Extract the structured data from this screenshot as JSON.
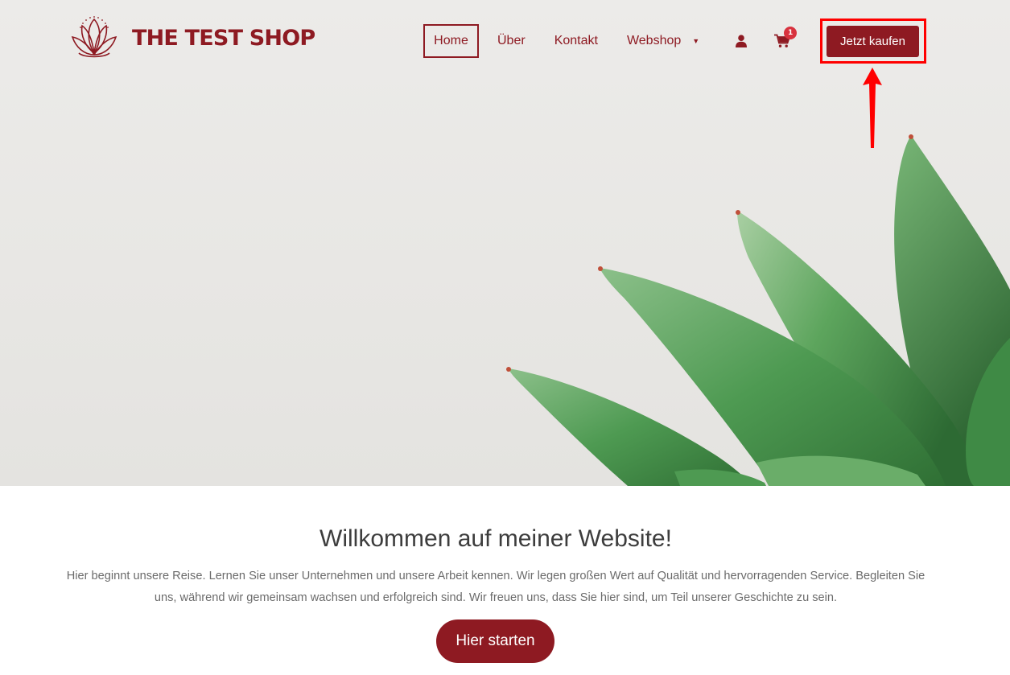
{
  "brand": {
    "name": "THE TEST SHOP",
    "color": "#8e1a22"
  },
  "nav": {
    "items": [
      {
        "label": "Home",
        "active": true
      },
      {
        "label": "Über"
      },
      {
        "label": "Kontakt"
      },
      {
        "label": "Webshop",
        "has_dropdown": true
      }
    ],
    "dropdown_caret": "▼",
    "user_icon": "user-icon",
    "cart": {
      "icon": "cart-icon",
      "count": "1"
    }
  },
  "cta": {
    "label": "Jetzt kaufen",
    "highlight_color": "#ff0000"
  },
  "hero": {
    "image": "succulent-plant"
  },
  "welcome": {
    "title": "Willkommen auf meiner Website!",
    "text": "Hier beginnt unsere Reise. Lernen Sie unser Unternehmen und unsere Arbeit kennen. Wir legen großen Wert auf Qualität und hervorragenden Service. Begleiten Sie uns, während wir gemeinsam wachsen und erfolgreich sind. Wir freuen uns, dass Sie hier sind, um Teil unserer Geschichte zu sein.",
    "button_label": "Hier starten"
  }
}
